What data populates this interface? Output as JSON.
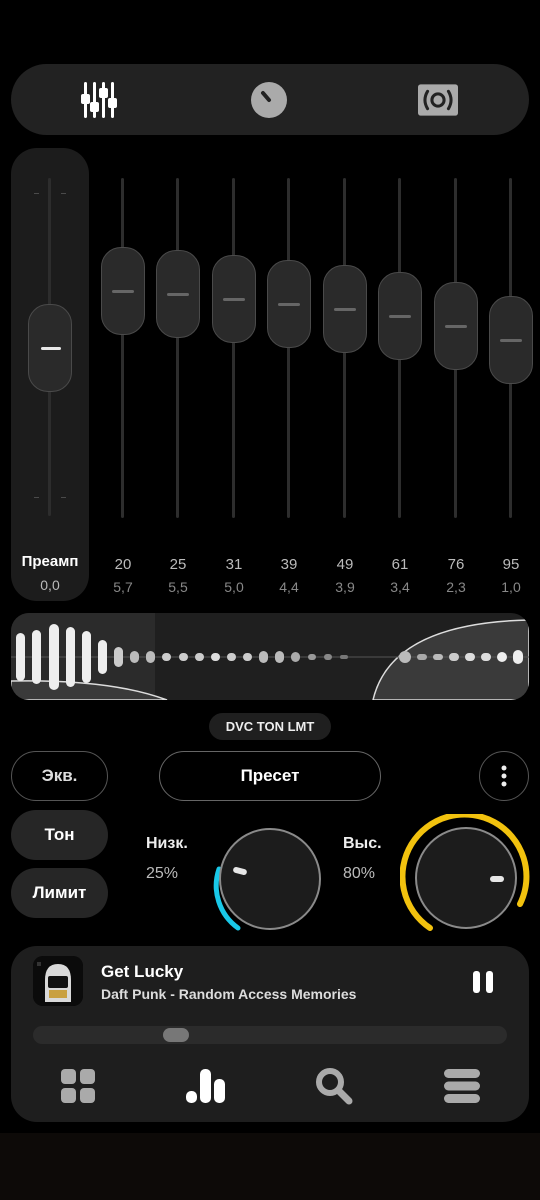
{
  "topbar": {
    "icons": [
      "equalizer-sliders-icon",
      "knob-icon",
      "speaker-icon"
    ]
  },
  "preamp": {
    "label": "Преамп",
    "value": "0,0"
  },
  "bands": [
    {
      "freq": "20",
      "gain": "5,7"
    },
    {
      "freq": "25",
      "gain": "5,5"
    },
    {
      "freq": "31",
      "gain": "5,0"
    },
    {
      "freq": "39",
      "gain": "4,4"
    },
    {
      "freq": "49",
      "gain": "3,9"
    },
    {
      "freq": "61",
      "gain": "3,4"
    },
    {
      "freq": "76",
      "gain": "2,3"
    },
    {
      "freq": "95",
      "gain": "1,0"
    }
  ],
  "chip": {
    "label": "DVC TON LMT"
  },
  "buttons": {
    "eq": "Экв.",
    "preset": "Пресет",
    "tone": "Тон",
    "limit": "Лимит"
  },
  "bass": {
    "label": "Низк.",
    "value": "25%",
    "level": 0.25,
    "color": "#19c8e8"
  },
  "treble": {
    "label": "Выс.",
    "value": "80%",
    "level": 0.8,
    "color": "#f2c20e"
  },
  "player": {
    "title": "Get Lucky",
    "artist": "Daft Punk - Random Access Memories",
    "progress": 0.3
  },
  "nav": {
    "icons": [
      "grid-icon",
      "bars-icon",
      "search-icon",
      "menu-icon"
    ]
  }
}
